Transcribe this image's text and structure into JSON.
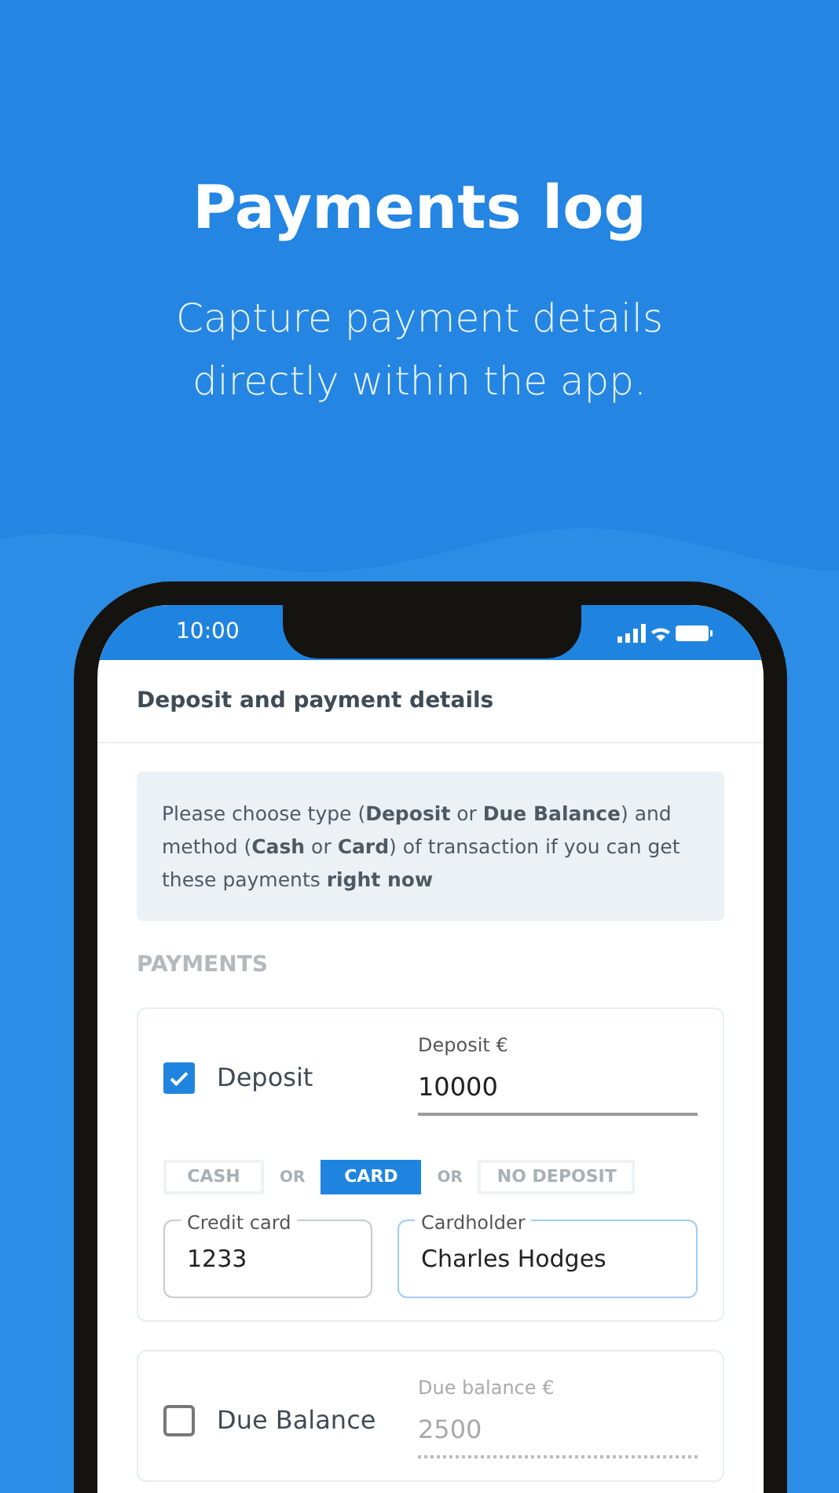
{
  "hero": {
    "title": "Payments log",
    "subtitle": "Capture payment details directly within the app."
  },
  "status_bar": {
    "time": "10:00"
  },
  "screen": {
    "title": "Deposit and payment details",
    "info": "Please choose type (**Deposit** or **Due Balance**) and method (**Cash** or **Card**) of transaction if you can get these payments **right now**",
    "section": "PAYMENTS",
    "payments": [
      {
        "label": "Deposit",
        "checked": true,
        "amount_label": "Deposit €",
        "amount": "10000",
        "methods": [
          {
            "label": "CASH",
            "selected": false
          },
          {
            "label": "CARD",
            "selected": true
          },
          {
            "label": "NO DEPOSIT",
            "selected": false
          }
        ],
        "separator": [
          "OR",
          "OR"
        ],
        "fields": [
          {
            "label": "Credit card",
            "value": "1233",
            "focused": false
          },
          {
            "label": "Cardholder",
            "value": "Charles Hodges",
            "focused": true
          }
        ]
      },
      {
        "label": "Due Balance",
        "checked": false,
        "amount_label": "Due balance €",
        "amount": "2500"
      }
    ]
  }
}
